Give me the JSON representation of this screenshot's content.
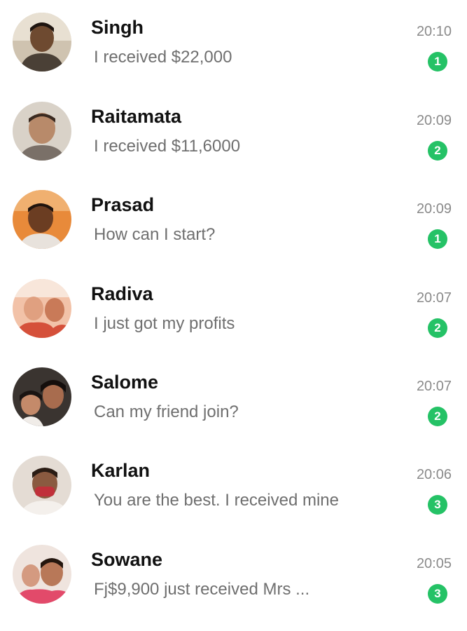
{
  "colors": {
    "badge": "#25c266",
    "name": "#111111",
    "preview": "#6f6f6f",
    "time": "#8a8a8a"
  },
  "chats": [
    {
      "name": "Singh",
      "preview": "I received $22,000",
      "time": "20:10",
      "unread": "1",
      "avatar": "avatar-icon"
    },
    {
      "name": "Raitamata",
      "preview": "I received $11,6000",
      "time": "20:09",
      "unread": "2",
      "avatar": "avatar-icon"
    },
    {
      "name": "Prasad",
      "preview": "How can I start?",
      "time": "20:09",
      "unread": "1",
      "avatar": "avatar-icon"
    },
    {
      "name": "Radiva",
      "preview": "I just got my profits",
      "time": "20:07",
      "unread": "2",
      "avatar": "avatar-icon"
    },
    {
      "name": "Salome",
      "preview": "Can my friend join?",
      "time": "20:07",
      "unread": "2",
      "avatar": "avatar-icon"
    },
    {
      "name": "Karlan",
      "preview": "You are the best. I received mine",
      "time": "20:06",
      "unread": "3",
      "avatar": "avatar-icon"
    },
    {
      "name": "Sowane",
      "preview": "Fj$9,900 just received Mrs  ...",
      "time": "20:05",
      "unread": "3",
      "avatar": "avatar-icon"
    }
  ]
}
